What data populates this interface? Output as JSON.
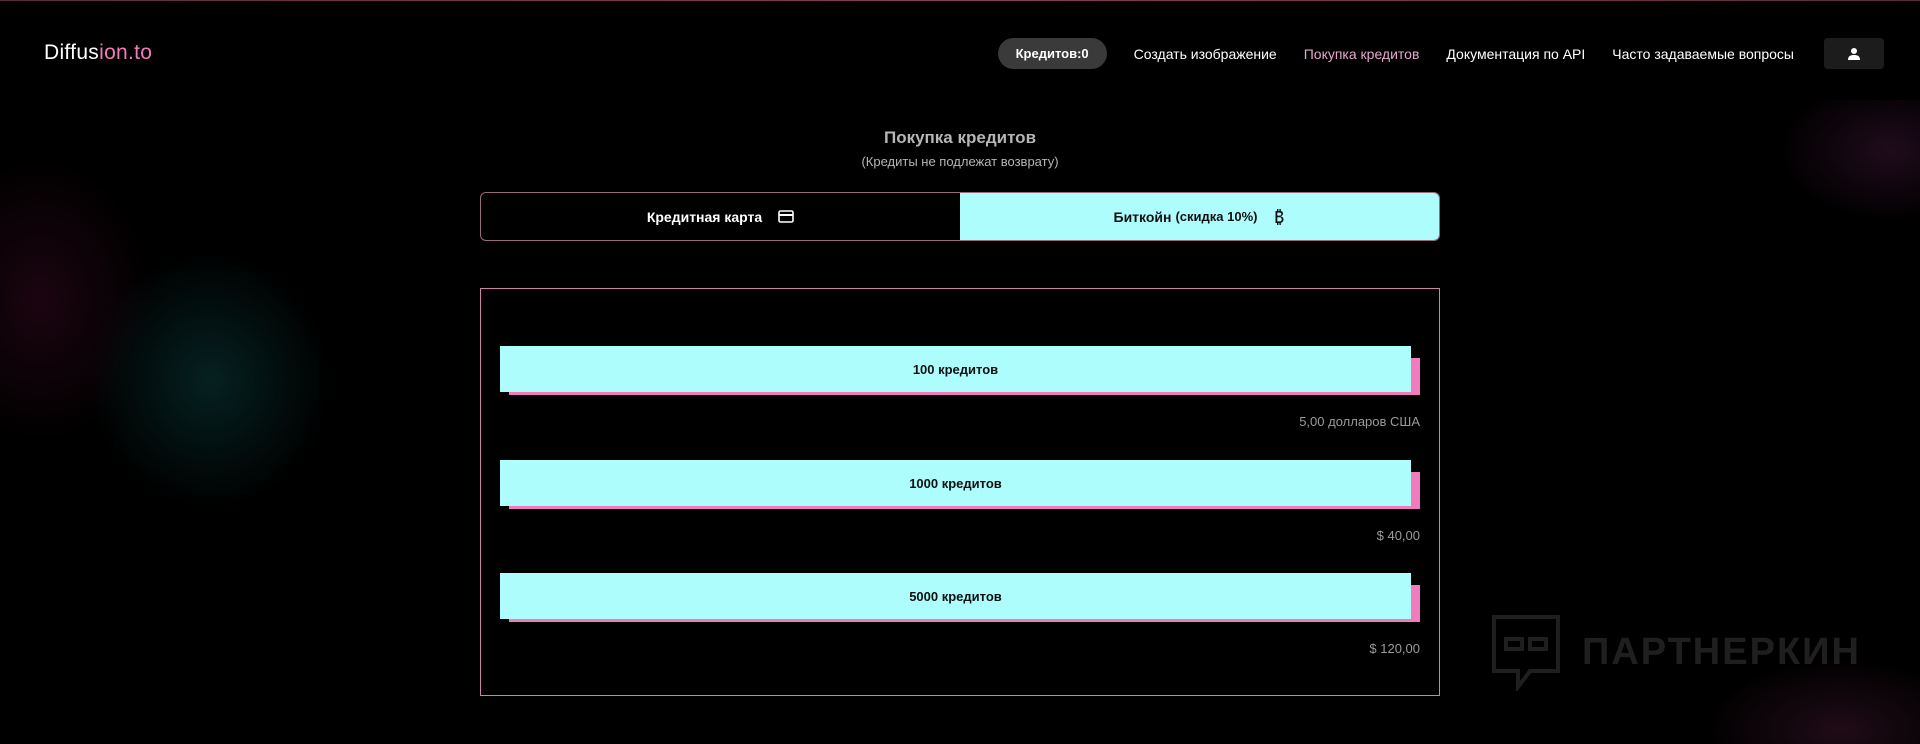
{
  "header": {
    "logo_prefix": "Diffus",
    "logo_accent": "ion.to",
    "credits_badge": "Кредитов:0",
    "nav": [
      {
        "label": "Создать изображение",
        "active": false
      },
      {
        "label": "Покупка кредитов",
        "active": true
      },
      {
        "label": "Документация по API",
        "active": false
      },
      {
        "label": "Часто задаваемые вопросы",
        "active": false
      }
    ],
    "user_icon": "user-icon"
  },
  "main": {
    "title": "Покупка кредитов",
    "subtitle": "(Кредиты не подлежат возврату)",
    "tabs": [
      {
        "label": "Кредитная карта",
        "note": "",
        "icon": "credit-card-icon",
        "selected": false
      },
      {
        "label": "Биткойн",
        "note": "(скидка 10%)",
        "icon": "bitcoin-icon",
        "selected": true
      }
    ],
    "packages": [
      {
        "label": "100 кредитов",
        "price": "5,00 долларов США"
      },
      {
        "label": "1000 кредитов",
        "price": "$ 40,00"
      },
      {
        "label": "5000 кредитов",
        "price": "$ 120,00"
      }
    ]
  },
  "watermark": {
    "text": "ПАРТНЕРКИН"
  },
  "colors": {
    "accent_cyan": "#adfdfd",
    "accent_pink": "#f27bbd",
    "background": "#000000"
  }
}
